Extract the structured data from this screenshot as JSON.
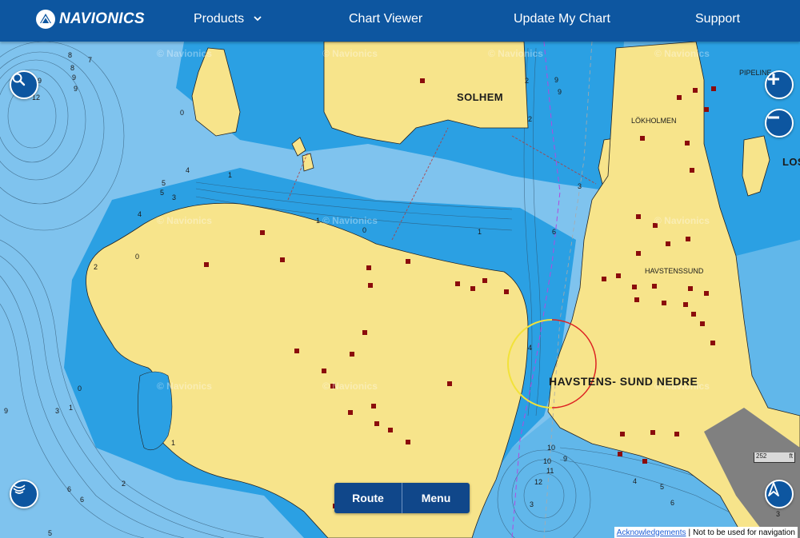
{
  "header": {
    "logo_text": "NAVIONICS",
    "nav": [
      {
        "label": "Products"
      },
      {
        "label": "Chart Viewer"
      },
      {
        "label": "Update My Chart"
      },
      {
        "label": "Support"
      }
    ]
  },
  "map": {
    "place_names": {
      "solhem": "SOLHEM",
      "lokholmen": "LÖKHOLMEN",
      "havstenssund": "HAVSTENSSUND",
      "havstens_sund_nedre": "HAVSTENS- SUND NEDRE",
      "pipeline": "PIPELINE",
      "los": "LOS"
    },
    "watermark": "© Navionics",
    "depths": [
      "9",
      "8",
      "7",
      "5",
      "9",
      "12",
      "1",
      "4",
      "5",
      "3",
      "2",
      "6",
      "0",
      "10",
      "11",
      "12",
      "1",
      "2",
      "3"
    ],
    "colors": {
      "land": "#f7e48b",
      "deep_water": "#7fc3ee",
      "shallow_water": "#2ba0e3",
      "marker": "#8b0c0c",
      "nav_blue": "#0d56a0"
    }
  },
  "controls": {
    "search_icon": "magnifier-icon",
    "zoom_in_icon": "plus-icon",
    "zoom_out_icon": "minus-icon",
    "sonar_icon": "sonar-icon",
    "compass_icon": "compass-icon"
  },
  "buttons": {
    "route": "Route",
    "menu": "Menu"
  },
  "scale": {
    "value": "252",
    "unit": "ft"
  },
  "footer": {
    "ack": "Acknowledgements",
    "sep": "|",
    "note": "Not to be used for navigation"
  }
}
